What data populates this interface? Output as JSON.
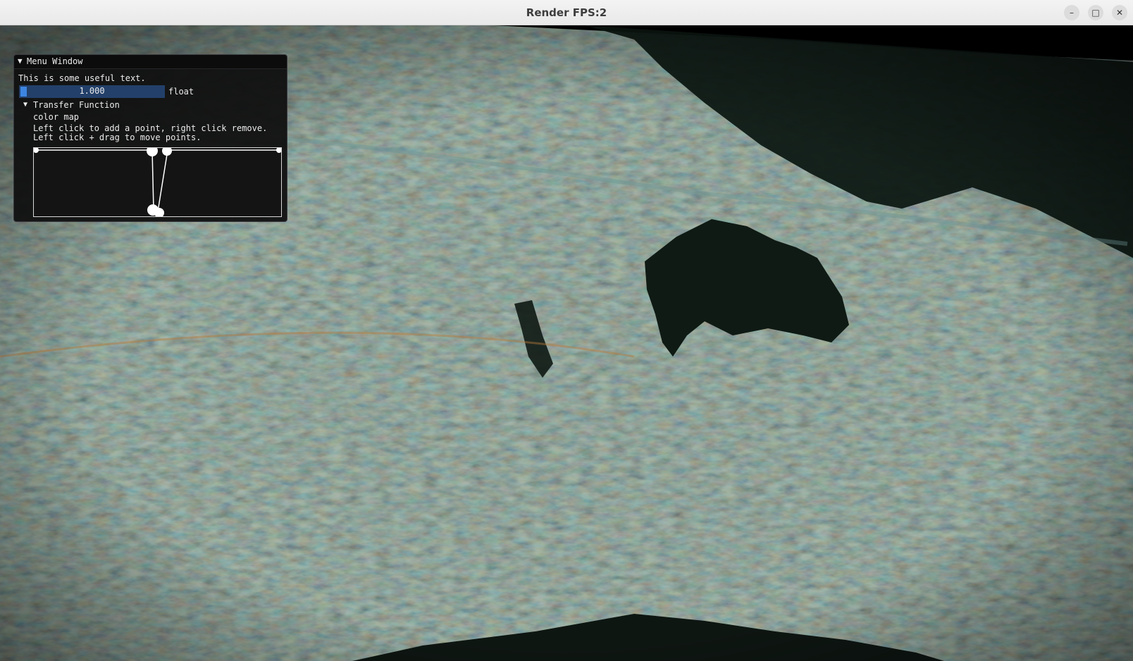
{
  "window": {
    "title": "Render FPS:2",
    "controls": {
      "minimize": "–",
      "maximize": "□",
      "close": "✕"
    }
  },
  "menu": {
    "title": "Menu Window",
    "collapse_icon": "▼",
    "text": "This is some useful text.",
    "slider": {
      "value": "1.000",
      "label": "float",
      "fraction": 0.0
    },
    "transfer_function": {
      "header_icon": "▼",
      "header": "Transfer Function",
      "color_map_label": "color map",
      "help_line1": "Left click to add a point, right click remove.",
      "help_line2": "Left click + drag to move points."
    }
  },
  "colors": {
    "slider_bg": "#23406a",
    "slider_grab": "#3d85e0",
    "panel_bg": "#0f0f0f",
    "ocean_teal": "#4a7f83",
    "ocean_gold": "#b59a4c",
    "land": "#0f1a15"
  }
}
